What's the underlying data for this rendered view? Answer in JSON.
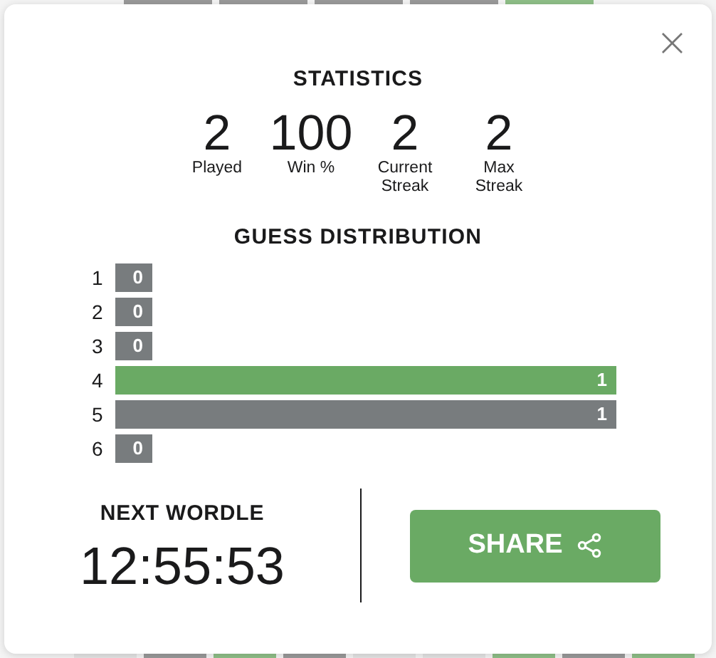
{
  "background_tiles_top": [
    {
      "color": "#9a9a9a"
    },
    {
      "color": "#9a9a9a"
    },
    {
      "color": "#9a9a9a"
    },
    {
      "color": "#9a9a9a"
    },
    {
      "color": "#8fbf88"
    }
  ],
  "background_tiles_bottom": [
    {
      "color": "#e4e4e4"
    },
    {
      "color": "#9a9a9a"
    },
    {
      "color": "#8fbf88"
    },
    {
      "color": "#9a9a9a"
    },
    {
      "color": "#e4e4e4"
    },
    {
      "color": "#e4e4e4"
    },
    {
      "color": "#8fbf88"
    },
    {
      "color": "#9a9a9a"
    },
    {
      "color": "#8fbf88"
    }
  ],
  "close": "×",
  "title": "STATISTICS",
  "stats": [
    {
      "value": "2",
      "label": "Played"
    },
    {
      "value": "100",
      "label": "Win %"
    },
    {
      "value": "2",
      "label": "Current Streak"
    },
    {
      "value": "2",
      "label": "Max Streak"
    }
  ],
  "distribution_title": "GUESS DISTRIBUTION",
  "distribution": [
    {
      "guess": "1",
      "count": "0",
      "highlight": false
    },
    {
      "guess": "2",
      "count": "0",
      "highlight": false
    },
    {
      "guess": "3",
      "count": "0",
      "highlight": false
    },
    {
      "guess": "4",
      "count": "1",
      "highlight": true
    },
    {
      "guess": "5",
      "count": "1",
      "highlight": false
    },
    {
      "guess": "6",
      "count": "0",
      "highlight": false
    }
  ],
  "next_label": "NEXT WORDLE",
  "timer": "12:55:53",
  "share_label": "SHARE"
}
